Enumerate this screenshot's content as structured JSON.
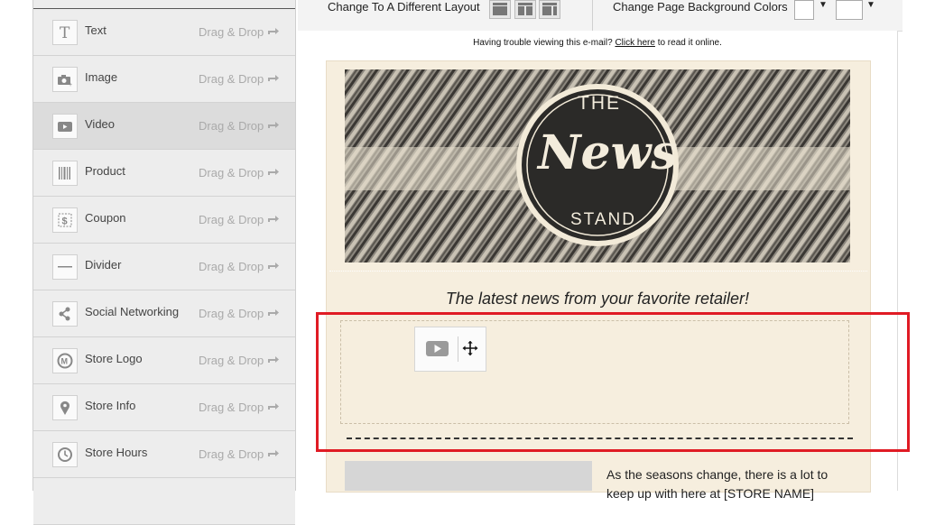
{
  "sidebar": {
    "drag_label": "Drag & Drop",
    "items": [
      {
        "label": "Text",
        "icon": "text-icon"
      },
      {
        "label": "Image",
        "icon": "camera-icon"
      },
      {
        "label": "Video",
        "icon": "video-icon"
      },
      {
        "label": "Product",
        "icon": "barcode-icon"
      },
      {
        "label": "Coupon",
        "icon": "coupon-icon"
      },
      {
        "label": "Divider",
        "icon": "divider-icon"
      },
      {
        "label": "Social Networking",
        "icon": "share-icon"
      },
      {
        "label": "Store Logo",
        "icon": "logo-icon"
      },
      {
        "label": "Store Info",
        "icon": "map-pin-icon"
      },
      {
        "label": "Store Hours",
        "icon": "clock-icon"
      }
    ]
  },
  "toolbar": {
    "layout_label": "Change To A Different Layout",
    "background_label": "Change Page Background Colors",
    "swatch_colors": [
      "#ffffff",
      "#ffffff"
    ]
  },
  "email": {
    "trouble_text": "Having trouble viewing this e-mail?",
    "trouble_link": "Click here",
    "trouble_suffix": "to read it online.",
    "logo_the": "THE",
    "logo_news": "News",
    "logo_stand": "STAND",
    "tagline": "The latest news from your favorite retailer!",
    "body_text_line1": "As the seasons change, there is a lot to",
    "body_text_line2": "keep up with here at [STORE NAME]",
    "background_color": "#f6eede",
    "highlight_color": "#e01b24"
  }
}
